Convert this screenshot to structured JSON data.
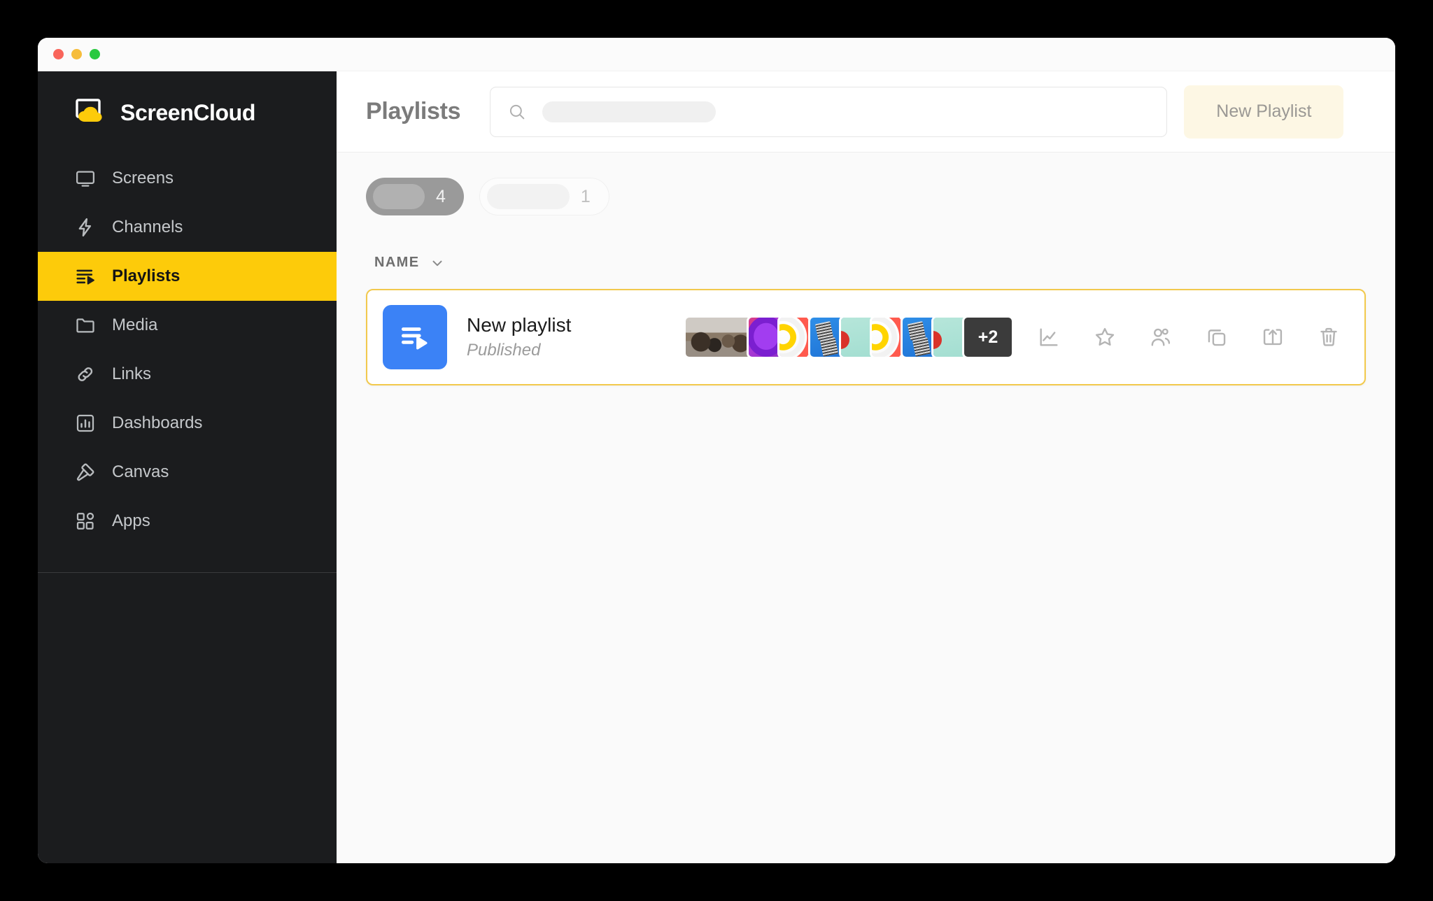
{
  "window": {
    "traffic_lights": [
      {
        "name": "close",
        "color": "#f9655b"
      },
      {
        "name": "minimize",
        "color": "#f6bd3b"
      },
      {
        "name": "maximize",
        "color": "#2ac940"
      }
    ]
  },
  "sidebar": {
    "brand": "ScreenCloud",
    "brand_logo_icon": "screencloud-cloud-logo",
    "items": [
      {
        "label": "Screens",
        "icon": "monitor-icon",
        "active": false
      },
      {
        "label": "Channels",
        "icon": "lightning-icon",
        "active": false
      },
      {
        "label": "Playlists",
        "icon": "playlist-icon",
        "active": true
      },
      {
        "label": "Media",
        "icon": "folder-icon",
        "active": false
      },
      {
        "label": "Links",
        "icon": "link-icon",
        "active": false
      },
      {
        "label": "Dashboards",
        "icon": "bar-chart-icon",
        "active": false
      },
      {
        "label": "Canvas",
        "icon": "paint-roller-icon",
        "active": false
      },
      {
        "label": "Apps",
        "icon": "apps-grid-icon",
        "active": false
      }
    ]
  },
  "header": {
    "title": "Playlists",
    "search": {
      "icon": "search-icon",
      "value": "",
      "placeholder": ""
    },
    "new_playlist_label": "New Playlist"
  },
  "filters": [
    {
      "label": "",
      "count": "4",
      "selected": true
    },
    {
      "label": "",
      "count": "1",
      "selected": false
    }
  ],
  "table": {
    "column_header": "NAME",
    "sort_chevron_icon": "chevron-down-icon",
    "rows": [
      {
        "icon": "playlist-tile-icon",
        "title": "New playlist",
        "status": "Published",
        "thumbnails": [
          {
            "art": "art-meeting",
            "name": "thumb-meeting-photo"
          },
          {
            "art": "art-purple",
            "name": "thumb-purple-abstract"
          },
          {
            "art": "art-rings",
            "name": "thumb-color-rings"
          },
          {
            "art": "art-blue",
            "name": "thumb-blue-newspaper"
          },
          {
            "art": "art-mint",
            "name": "thumb-mint-plain"
          },
          {
            "art": "art-rings",
            "name": "thumb-color-rings-2"
          },
          {
            "art": "art-blue",
            "name": "thumb-blue-newspaper-2"
          },
          {
            "art": "art-mint",
            "name": "thumb-mint-plain-2"
          }
        ],
        "more_count": "+2",
        "actions": [
          {
            "icon": "analytics-icon",
            "label": "Analytics"
          },
          {
            "icon": "star-icon",
            "label": "Favorite"
          },
          {
            "icon": "share-users-icon",
            "label": "Share"
          },
          {
            "icon": "duplicate-icon",
            "label": "Duplicate"
          },
          {
            "icon": "publish-upload-icon",
            "label": "Publish"
          },
          {
            "icon": "trash-icon",
            "label": "Delete"
          }
        ]
      }
    ]
  },
  "colors": {
    "brand_yellow": "#fdcb0a",
    "sidebar_bg": "#1b1c1e",
    "row_border": "#f2c94c",
    "playlist_tile_blue": "#3b82f6",
    "new_playlist_bg": "#fdf7e4"
  }
}
